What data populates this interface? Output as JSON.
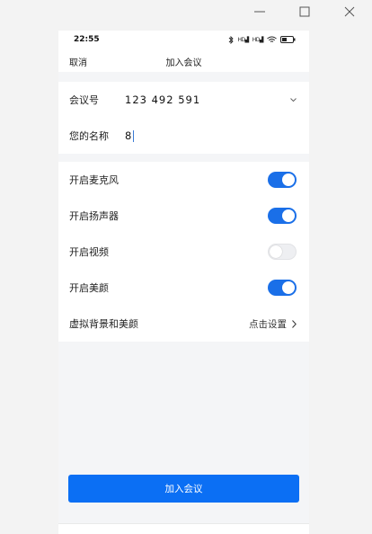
{
  "status_bar": {
    "time": "22:55",
    "signal_1": "HD",
    "signal_2": "HD"
  },
  "nav": {
    "cancel": "取消",
    "title": "加入会议"
  },
  "meeting": {
    "id_label": "会议号",
    "id_value": "123 492 591",
    "name_label": "您的名称",
    "name_value": "8"
  },
  "settings": [
    {
      "label": "开启麦克风",
      "on": true
    },
    {
      "label": "开启扬声器",
      "on": true
    },
    {
      "label": "开启视频",
      "on": false
    },
    {
      "label": "开启美颜",
      "on": true
    }
  ],
  "virtual_bg": {
    "label": "虚拟背景和美颜",
    "action": "点击设置"
  },
  "join_button": "加入会议",
  "colors": {
    "accent": "#0b6ff4",
    "toggle_on": "#1a6fe8"
  }
}
